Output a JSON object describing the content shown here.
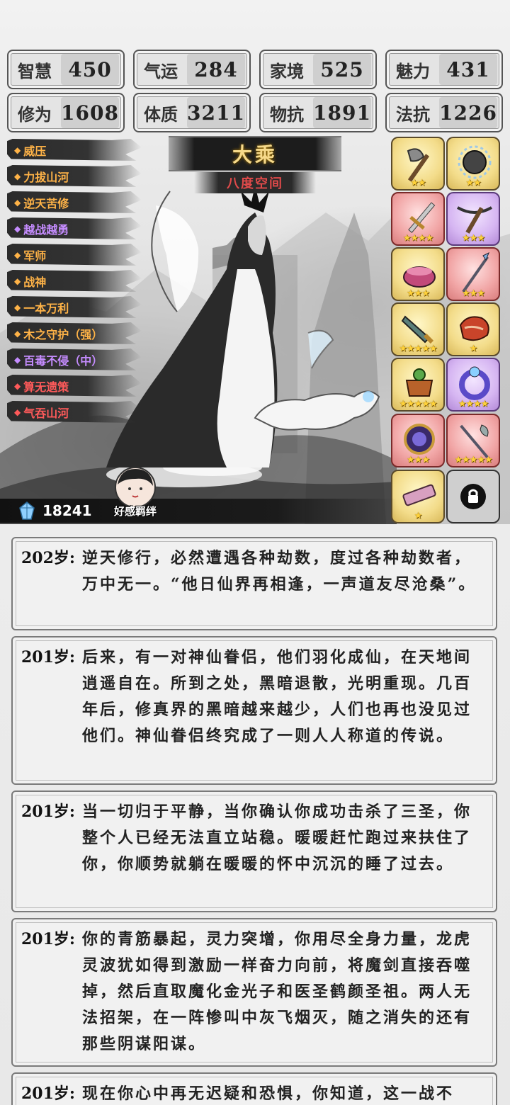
{
  "stats": [
    {
      "label": "智慧",
      "value": "450"
    },
    {
      "label": "气运",
      "value": "284"
    },
    {
      "label": "家境",
      "value": "525"
    },
    {
      "label": "魅力",
      "value": "431"
    },
    {
      "label": "修为",
      "value": "1608"
    },
    {
      "label": "体质",
      "value": "3211"
    },
    {
      "label": "物抗",
      "value": "1891"
    },
    {
      "label": "法抗",
      "value": "1226"
    }
  ],
  "realm": {
    "title": "大乘",
    "subtitle": "八度空间"
  },
  "traits": [
    {
      "label": "威压",
      "color": "orange"
    },
    {
      "label": "力拔山河",
      "color": "orange"
    },
    {
      "label": "逆天苦修",
      "color": "orange"
    },
    {
      "label": "越战越勇",
      "color": "purple"
    },
    {
      "label": "军师",
      "color": "orange"
    },
    {
      "label": "战神",
      "color": "orange"
    },
    {
      "label": "一本万利",
      "color": "orange"
    },
    {
      "label": "木之守护（强）",
      "color": "orange"
    },
    {
      "label": "百毒不侵（中）",
      "color": "purple"
    },
    {
      "label": "算无遗策",
      "color": "red"
    },
    {
      "label": "气吞山河",
      "color": "red"
    }
  ],
  "equipment": [
    {
      "icon": "battle-axe-icon",
      "rarity": "gold",
      "stars": "★★"
    },
    {
      "icon": "spiked-orb-icon",
      "rarity": "gold",
      "stars": "★★"
    },
    {
      "icon": "sword-icon",
      "rarity": "red",
      "stars": "★★★★"
    },
    {
      "icon": "crossbow-icon",
      "rarity": "purple",
      "stars": "★★★"
    },
    {
      "icon": "cauldron-icon",
      "rarity": "gold",
      "stars": "★★★"
    },
    {
      "icon": "spear-icon",
      "rarity": "red",
      "stars": "★★★"
    },
    {
      "icon": "dagger-icon",
      "rarity": "gold",
      "stars": "★★★★★"
    },
    {
      "icon": "meat-icon",
      "rarity": "gold",
      "stars": "★"
    },
    {
      "icon": "incense-burner-icon",
      "rarity": "gold",
      "stars": "★★★★★"
    },
    {
      "icon": "ring-icon",
      "rarity": "purple",
      "stars": "★★★★"
    },
    {
      "icon": "mirror-icon",
      "rarity": "red",
      "stars": "★★★"
    },
    {
      "icon": "halberd-icon",
      "rarity": "red",
      "stars": "★★★★★"
    },
    {
      "icon": "scroll-icon",
      "rarity": "gold",
      "stars": "★"
    }
  ],
  "gems": "18241",
  "affection_label": "好感羁绊",
  "log": [
    {
      "age": "202岁:",
      "text": "逆天修行，必然遭遇各种劫数，度过各种劫数者，万中无一。“他日仙界再相逢，一声道友尽沧桑”。"
    },
    {
      "age": "201岁:",
      "text": "后来，有一对神仙眷侣，他们羽化成仙，在天地间逍遥自在。所到之处，黑暗退散，光明重现。几百年后，修真界的黑暗越来越少，人们也再也没见过他们。神仙眷侣终究成了一则人人称道的传说。"
    },
    {
      "age": "201岁:",
      "text": "当一切归于平静，当你确认你成功击杀了三圣，你整个人已经无法直立站稳。暖暖赶忙跑过来扶住了你，你顺势就躺在暖暖的怀中沉沉的睡了过去。"
    },
    {
      "age": "201岁:",
      "text": "你的青筋暴起，灵力突增，你用尽全身力量，龙虎灵波犹如得到激励一样奋力向前，将魔剑直接吞噬掉，然后直取魔化金光子和医圣鹤颜圣祖。两人无法招架，在一阵惨叫中灰飞烟灭，随之消失的还有那些阴谋阳谋。"
    },
    {
      "age": "201岁:",
      "text": "现在你心中再无迟疑和恐惧，你知道，这一战不"
    }
  ]
}
